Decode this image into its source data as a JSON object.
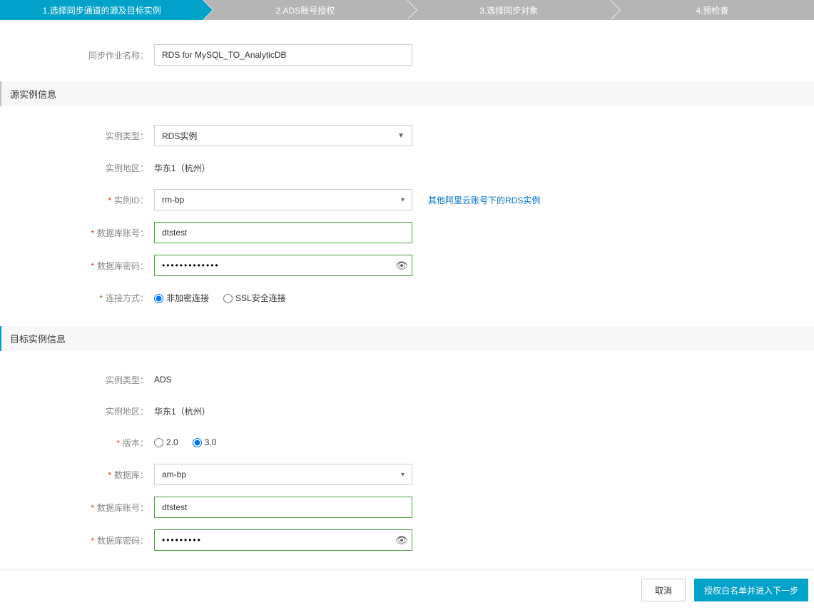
{
  "steps": [
    {
      "label": "1.选择同步通道的源及目标实例",
      "active": true
    },
    {
      "label": "2.ADS账号授权",
      "active": false
    },
    {
      "label": "3.选择同步对象",
      "active": false
    },
    {
      "label": "4.预检查",
      "active": false
    }
  ],
  "jobName": {
    "label": "同步作业名称：",
    "value": "RDS for MySQL_TO_AnalyticDB"
  },
  "source": {
    "sectionTitle": "源实例信息",
    "instanceType": {
      "label": "实例类型：",
      "value": "RDS实例"
    },
    "region": {
      "label": "实例地区：",
      "value": "华东1（杭州）"
    },
    "instanceId": {
      "label": "实例ID：",
      "value": "rm-bp"
    },
    "otherAccountLink": "其他阿里云账号下的RDS实例",
    "dbAccount": {
      "label": "数据库账号：",
      "value": "dtstest"
    },
    "dbPassword": {
      "label": "数据库密码：",
      "value": "•••••••••••••"
    },
    "connectMode": {
      "label": "连接方式：",
      "options": [
        {
          "text": "非加密连接",
          "checked": true
        },
        {
          "text": "SSL安全连接",
          "checked": false
        }
      ]
    }
  },
  "target": {
    "sectionTitle": "目标实例信息",
    "instanceType": {
      "label": "实例类型：",
      "value": "ADS"
    },
    "region": {
      "label": "实例地区：",
      "value": "华东1（杭州）"
    },
    "version": {
      "label": "版本：",
      "options": [
        {
          "text": "2.0",
          "checked": false
        },
        {
          "text": "3.0",
          "checked": true
        }
      ]
    },
    "database": {
      "label": "数据库：",
      "value": "am-bp"
    },
    "dbAccount": {
      "label": "数据库账号：",
      "value": "dtstest"
    },
    "dbPassword": {
      "label": "数据库密码：",
      "value": "•••••••••"
    }
  },
  "footer": {
    "cancel": "取消",
    "next": "授权白名单并进入下一步"
  }
}
